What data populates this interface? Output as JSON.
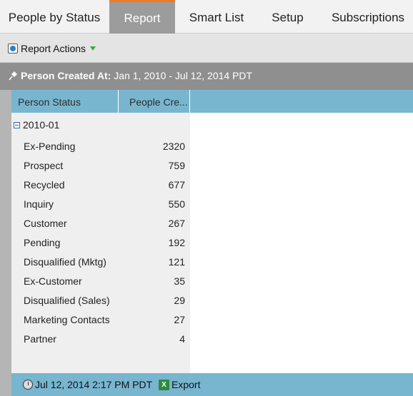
{
  "tabs": [
    {
      "label": "People by Status",
      "active": false
    },
    {
      "label": "Report",
      "active": true
    },
    {
      "label": "Smart List",
      "active": false
    },
    {
      "label": "Setup",
      "active": false
    },
    {
      "label": "Subscriptions",
      "active": false
    }
  ],
  "actions": {
    "label": "Report Actions"
  },
  "filter": {
    "label": "Person Created At:",
    "value": "Jan 1, 2010 - Jul 12, 2014 PDT"
  },
  "grid": {
    "columns": [
      "Person Status",
      "People Cre..."
    ],
    "group": "2010-01",
    "rows": [
      {
        "status": "Ex-Pending",
        "count": "2320"
      },
      {
        "status": "Prospect",
        "count": "759"
      },
      {
        "status": "Recycled",
        "count": "677"
      },
      {
        "status": "Inquiry",
        "count": "550"
      },
      {
        "status": "Customer",
        "count": "267"
      },
      {
        "status": "Pending",
        "count": "192"
      },
      {
        "status": "Disqualified (Mktg)",
        "count": "121"
      },
      {
        "status": "Ex-Customer",
        "count": "35"
      },
      {
        "status": "Disqualified (Sales)",
        "count": "29"
      },
      {
        "status": "Marketing Contacts",
        "count": "27"
      },
      {
        "status": "Partner",
        "count": "4"
      }
    ]
  },
  "footer": {
    "timestamp": "Jul 12, 2014 2:17 PM PDT",
    "export_label": "Export"
  },
  "colors": {
    "accent": "#f07a1f",
    "header_blue": "#78b6d0",
    "tab_active": "#9c9c9c"
  }
}
